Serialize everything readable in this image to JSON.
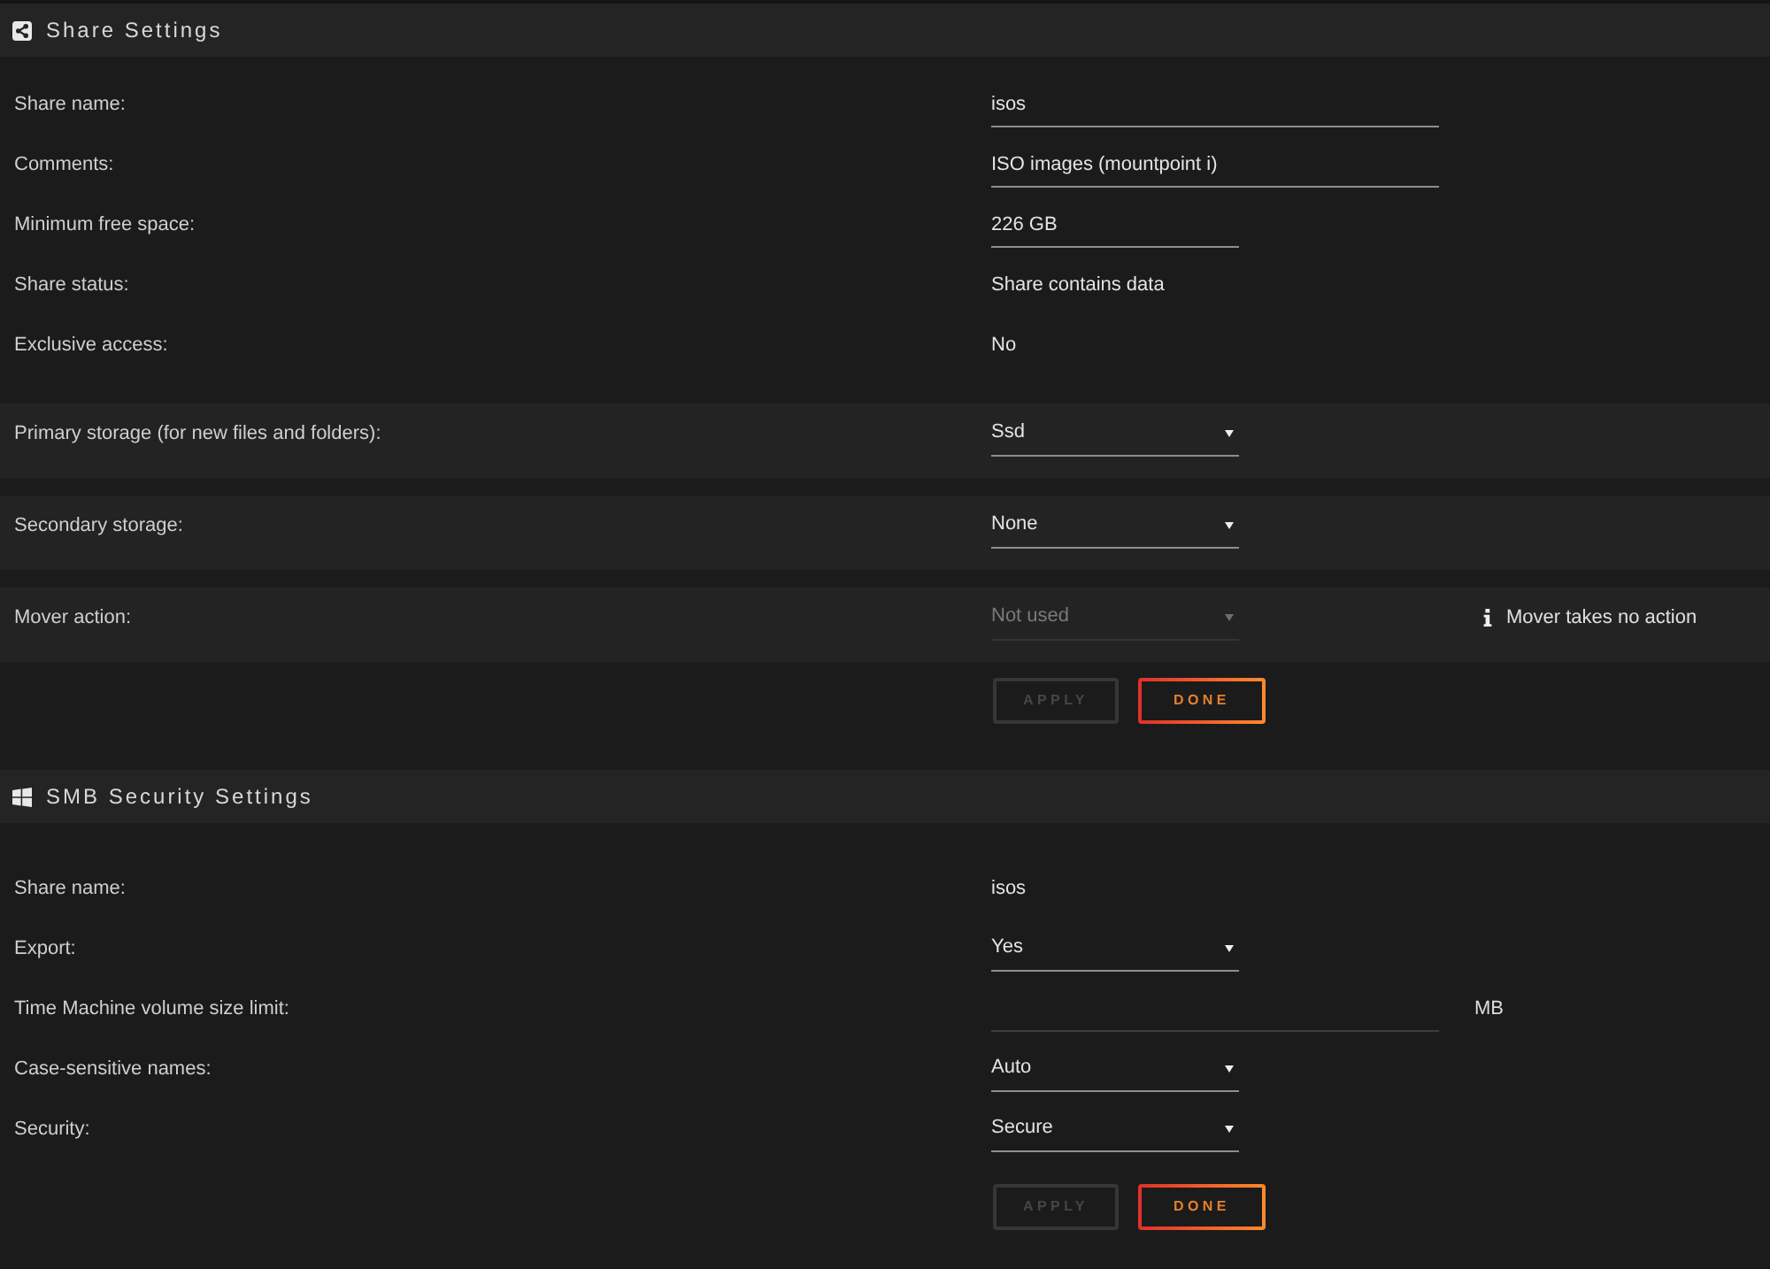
{
  "sections": [
    {
      "kind": "share",
      "title": "Share Settings",
      "fields": [
        {
          "kind": "text_field",
          "label": "Share name:",
          "value": "isos",
          "disabled": false
        },
        {
          "kind": "text_field",
          "label": "Comments:",
          "value": "ISO images (mountpoint i)",
          "disabled": false
        },
        {
          "kind": "size_field",
          "label": "Minimum free space:",
          "value": "226 GB",
          "disabled": false
        },
        {
          "kind": "text",
          "label": "Share status:",
          "value": "Share contains data",
          "disabled": false
        },
        {
          "kind": "text",
          "label": "Exclusive access:",
          "value": "No",
          "disabled": false
        }
      ],
      "storage_rows": [
        {
          "kind": "select",
          "label": "Primary storage (for new files and folders):",
          "value": "Ssd",
          "disabled": false
        },
        {
          "kind": "select",
          "label": "Secondary storage:",
          "value": "None",
          "disabled": false
        },
        {
          "kind": "select",
          "label": "Mover action:",
          "value": "Not used",
          "disabled": true,
          "note": "Mover takes no action"
        }
      ],
      "buttons": [
        {
          "label": "APPLY",
          "disabled": true
        },
        {
          "label": "DONE",
          "disabled": false
        }
      ]
    },
    {
      "kind": "smb",
      "title": "SMB Security Settings",
      "fields": [
        {
          "kind": "text",
          "label": "Share name:",
          "value": "isos",
          "disabled": false
        },
        {
          "kind": "select",
          "label": "Export:",
          "value": "Yes",
          "disabled": false
        },
        {
          "kind": "text_field",
          "label": "Time Machine volume size limit:",
          "unit": "MB",
          "disabled": false
        },
        {
          "kind": "select",
          "label": "Case-sensitive names:",
          "value": "Auto",
          "disabled": false
        },
        {
          "kind": "select",
          "label": "Security:",
          "value": "Secure",
          "disabled": false
        }
      ],
      "buttons": [
        {
          "label": "APPLY",
          "disabled": true
        },
        {
          "label": "DONE",
          "disabled": false
        }
      ]
    }
  ]
}
